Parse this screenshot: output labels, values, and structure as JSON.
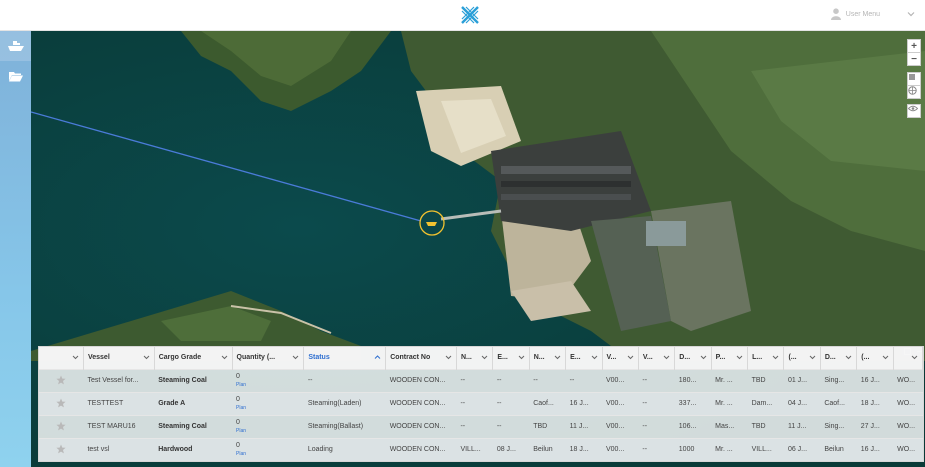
{
  "header": {
    "user_menu_label": "User Menu"
  },
  "map": {
    "zoom_in_label": "+",
    "zoom_out_label": "−"
  },
  "grid": {
    "columns": [
      {
        "label": "",
        "sorted": false
      },
      {
        "label": "Vessel",
        "sorted": false
      },
      {
        "label": "Cargo Grade",
        "sorted": false
      },
      {
        "label": "Quantity (...",
        "sorted": false
      },
      {
        "label": "Status",
        "sorted": true
      },
      {
        "label": "Contract No",
        "sorted": false
      },
      {
        "label": "N...",
        "sorted": false
      },
      {
        "label": "E...",
        "sorted": false
      },
      {
        "label": "N...",
        "sorted": false
      },
      {
        "label": "E...",
        "sorted": false
      },
      {
        "label": "V...",
        "sorted": false
      },
      {
        "label": "V...",
        "sorted": false
      },
      {
        "label": "D...",
        "sorted": false
      },
      {
        "label": "P...",
        "sorted": false
      },
      {
        "label": "L...",
        "sorted": false
      },
      {
        "label": "(...",
        "sorted": false
      },
      {
        "label": "D...",
        "sorted": false
      },
      {
        "label": "(...",
        "sorted": false
      },
      {
        "label": "",
        "sorted": false
      }
    ],
    "plan_label": "Plan",
    "rows": [
      {
        "vessel": "Test Vessel for...",
        "cargo": "Steaming Coal",
        "qty": "0",
        "status": "--",
        "contract": "WOODEN CON...",
        "c6": "--",
        "c7": "--",
        "c8": "--",
        "c9": "--",
        "c10": "V00...",
        "c11": "--",
        "c12": "180...",
        "c13": "Mr. ...",
        "c14": "TBD",
        "c15": "01 J...",
        "c16": "Sing...",
        "c17": "16 J...",
        "c18": "WO..."
      },
      {
        "vessel": "TESTTEST",
        "cargo": "Grade A",
        "qty": "0",
        "status": "Steaming(Laden)",
        "contract": "WOODEN CON...",
        "c6": "--",
        "c7": "--",
        "c8": "Caof...",
        "c9": "16 J...",
        "c10": "V00...",
        "c11": "--",
        "c12": "337...",
        "c13": "Mr. ...",
        "c14": "Dam...",
        "c15": "04 J...",
        "c16": "Caof...",
        "c17": "18 J...",
        "c18": "WO..."
      },
      {
        "vessel": "TEST MARU16",
        "cargo": "Steaming Coal",
        "qty": "0",
        "status": "Steaming(Ballast)",
        "contract": "WOODEN CON...",
        "c6": "--",
        "c7": "--",
        "c8": "TBD",
        "c9": "11 J...",
        "c10": "V00...",
        "c11": "--",
        "c12": "106...",
        "c13": "Mas...",
        "c14": "TBD",
        "c15": "11 J...",
        "c16": "Sing...",
        "c17": "27 J...",
        "c18": "WO..."
      },
      {
        "vessel": "test vsl",
        "cargo": "Hardwood",
        "qty": "0",
        "status": "Loading",
        "contract": "WOODEN CON...",
        "c6": "VILL...",
        "c7": "08 J...",
        "c8": "Beilun",
        "c9": "18 J...",
        "c10": "V00...",
        "c11": "--",
        "c12": "1000",
        "c13": "Mr. ...",
        "c14": "VILL...",
        "c15": "06 J...",
        "c16": "Beilun",
        "c17": "16 J...",
        "c18": "WO..."
      }
    ]
  },
  "colors": {
    "accent": "#2f6fd0",
    "logo": "#2a9fd8",
    "sidebar": "#86c6e9",
    "vessel_marker": "#f2c230",
    "route_line": "#4a7bd8"
  }
}
